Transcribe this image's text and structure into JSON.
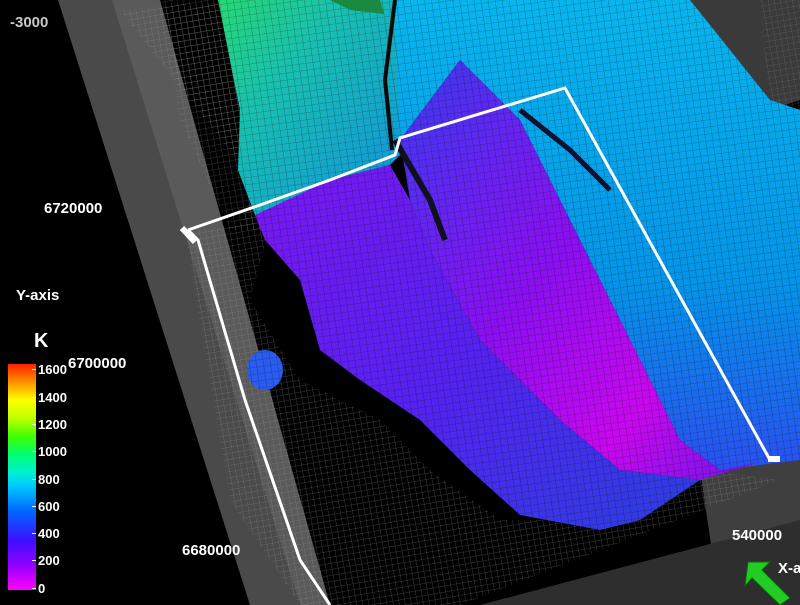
{
  "axes": {
    "z_tick_top": "-3000",
    "y_ticks": [
      "6720000",
      "6700000",
      "6680000"
    ],
    "y_title": "Y-axis",
    "x_tick": "540000",
    "x_title": "X-a"
  },
  "legend": {
    "title": "K",
    "ticks": [
      "1600",
      "1400",
      "1200",
      "1000",
      "800",
      "600",
      "400",
      "200",
      "0"
    ],
    "colors": {
      "low": "#ff00ff",
      "mid_low": "#3c10ff",
      "mid": "#00c8ff",
      "mid_high": "#40ff00",
      "high": "#ff2000"
    }
  },
  "scene": {
    "background": "#000000",
    "boundary_color": "#ffffff",
    "wireframe_color": "#a0a0a0",
    "orientation_arrow_color": "#22cc22",
    "orientation_icon": "green-arrow-icon"
  }
}
